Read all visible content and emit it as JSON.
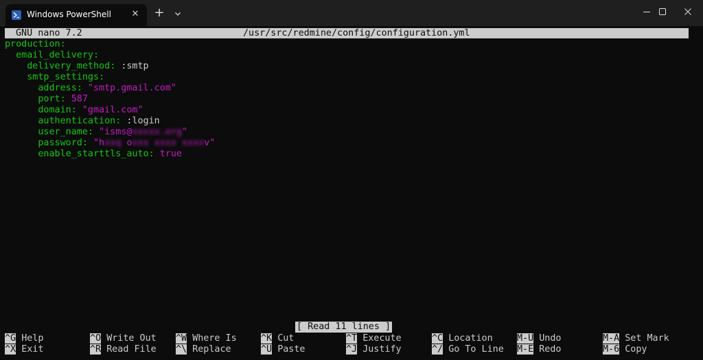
{
  "window": {
    "tab_title": "Windows PowerShell",
    "tab_close": "✕",
    "new_tab": "+",
    "icons": {
      "tab_icon": "powershell-icon",
      "dropdown": "chevron-down-icon",
      "minimize": "minimize-icon",
      "maximize": "maximize-icon",
      "close": "close-icon"
    }
  },
  "nano": {
    "version": "GNU nano 7.2",
    "filename": "/usr/src/redmine/config/configuration.yml",
    "status": "[ Read 11 lines ]"
  },
  "file": {
    "l1_key": "production",
    "l2_key": "email_delivery",
    "l3_key": "delivery_method",
    "l3_val": ":smtp",
    "l4_key": "smtp_settings",
    "l5_key": "address",
    "l5_val": "\"smtp.gmail.com\"",
    "l6_key": "port",
    "l6_val": "587",
    "l7_key": "domain",
    "l7_val": "\"gmail.com\"",
    "l8_key": "authentication",
    "l8_val": ":login",
    "l9_key": "user_name",
    "l9_val_visible": "\"isms@",
    "l9_val_hidden": "xxxxx.org",
    "l9_val_end": "\"",
    "l10_key": "password",
    "l10_val_a": "\"h",
    "l10_val_hidden_a": "xxq",
    "l10_val_b": " o",
    "l10_val_hidden_b": "xxx xxxx xxxx",
    "l10_val_c": "v\"",
    "l11_key": "enable_starttls_auto",
    "l11_val": "true"
  },
  "shortcuts": [
    {
      "key": "^G",
      "label": "Help"
    },
    {
      "key": "^X",
      "label": "Exit"
    },
    {
      "key": "^O",
      "label": "Write Out"
    },
    {
      "key": "^R",
      "label": "Read File"
    },
    {
      "key": "^W",
      "label": "Where Is"
    },
    {
      "key": "^\\",
      "label": "Replace"
    },
    {
      "key": "^K",
      "label": "Cut"
    },
    {
      "key": "^U",
      "label": "Paste"
    },
    {
      "key": "^T",
      "label": "Execute"
    },
    {
      "key": "^J",
      "label": "Justify"
    },
    {
      "key": "^C",
      "label": "Location"
    },
    {
      "key": "^/",
      "label": "Go To Line"
    },
    {
      "key": "M-U",
      "label": "Undo"
    },
    {
      "key": "M-E",
      "label": "Redo"
    },
    {
      "key": "M-A",
      "label": "Set Mark"
    },
    {
      "key": "M-6",
      "label": "Copy"
    }
  ],
  "colors": {
    "background": "#0c0c0c",
    "key": "#13c613",
    "string": "#c21bc2",
    "header": "#cccccc"
  }
}
